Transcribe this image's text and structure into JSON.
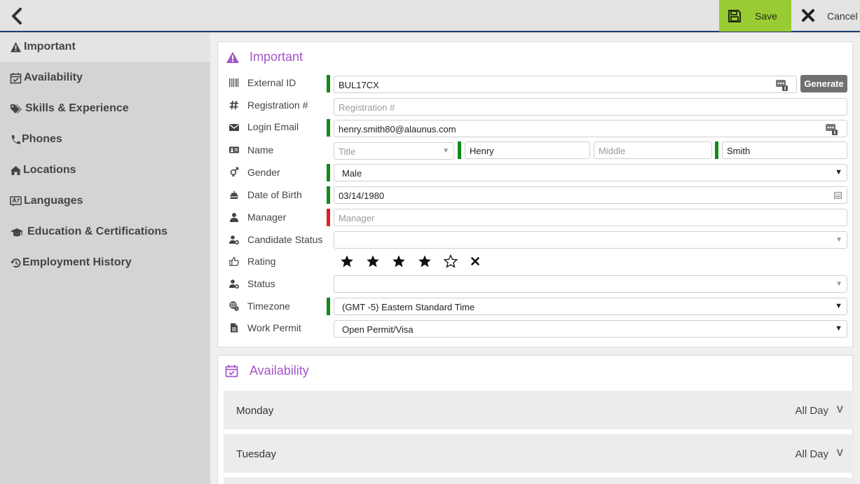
{
  "toolbar": {
    "save_label": "Save",
    "cancel_label": "Cancel"
  },
  "sidebar": {
    "items": [
      {
        "label": "Important",
        "icon": "warning-icon"
      },
      {
        "label": "Availability",
        "icon": "calendar-check-icon"
      },
      {
        "label": "Skills & Experience",
        "icon": "tags-icon"
      },
      {
        "label": "Phones",
        "icon": "phone-icon"
      },
      {
        "label": "Locations",
        "icon": "home-icon"
      },
      {
        "label": "Languages",
        "icon": "language-icon"
      },
      {
        "label": "Education & Certifications",
        "icon": "graduation-cap-icon"
      },
      {
        "label": "Employment History",
        "icon": "history-icon"
      }
    ]
  },
  "important": {
    "title": "Important",
    "external_id": {
      "label": "External ID",
      "value": "BUL17CX",
      "button": "Generate"
    },
    "registration": {
      "label": "Registration #",
      "placeholder": "Registration #"
    },
    "login_email": {
      "label": "Login Email",
      "value": "henry.smith80@alaunus.com"
    },
    "name": {
      "label": "Name",
      "title_placeholder": "Title",
      "first": "Henry",
      "middle_placeholder": "Middle",
      "last": "Smith"
    },
    "gender": {
      "label": "Gender",
      "value": "Male"
    },
    "dob": {
      "label": "Date of Birth",
      "value": "03/14/1980"
    },
    "manager": {
      "label": "Manager",
      "placeholder": "Manager"
    },
    "candidate_status": {
      "label": "Candidate Status",
      "value": ""
    },
    "rating": {
      "label": "Rating",
      "value": 4,
      "max": 5
    },
    "status": {
      "label": "Status",
      "value": ""
    },
    "timezone": {
      "label": "Timezone",
      "value": "(GMT -5) Eastern Standard Time"
    },
    "work_permit": {
      "label": "Work Permit",
      "value": "Open Permit/Visa"
    }
  },
  "availability": {
    "title": "Availability",
    "days": [
      {
        "day": "Monday",
        "value": "All Day"
      },
      {
        "day": "Tuesday",
        "value": "All Day"
      }
    ],
    "chevron": "V"
  },
  "colors": {
    "accent": "#a356c9",
    "save": "#99cc33",
    "required": "#138a17",
    "required_error": "#e21f1f"
  }
}
